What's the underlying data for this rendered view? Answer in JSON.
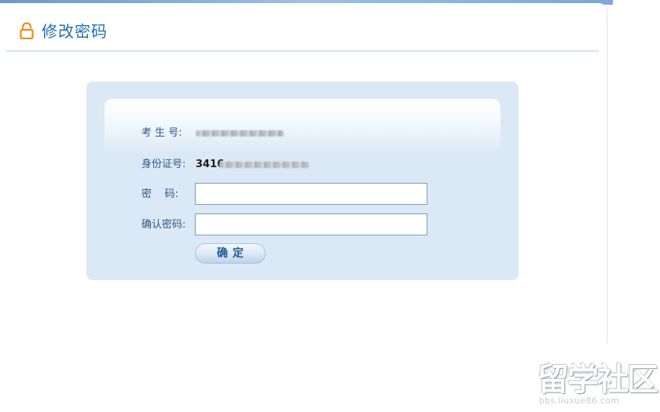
{
  "page": {
    "title": "修改密码"
  },
  "form": {
    "candidate_no_label": "考 生 号:",
    "id_no_label": "身份证号:",
    "id_no_prefix": "3416",
    "password_label": "密    码:",
    "password_value": "",
    "confirm_password_label": "确认密码:",
    "confirm_password_value": "",
    "submit_label": "确定"
  },
  "watermark": {
    "text": "留学社区",
    "subtext": "bbs.liuxue86.com"
  },
  "colors": {
    "accent": "#1f6fb2",
    "lock_icon": "#f08a1c",
    "box_bg": "#dbe8f5"
  }
}
